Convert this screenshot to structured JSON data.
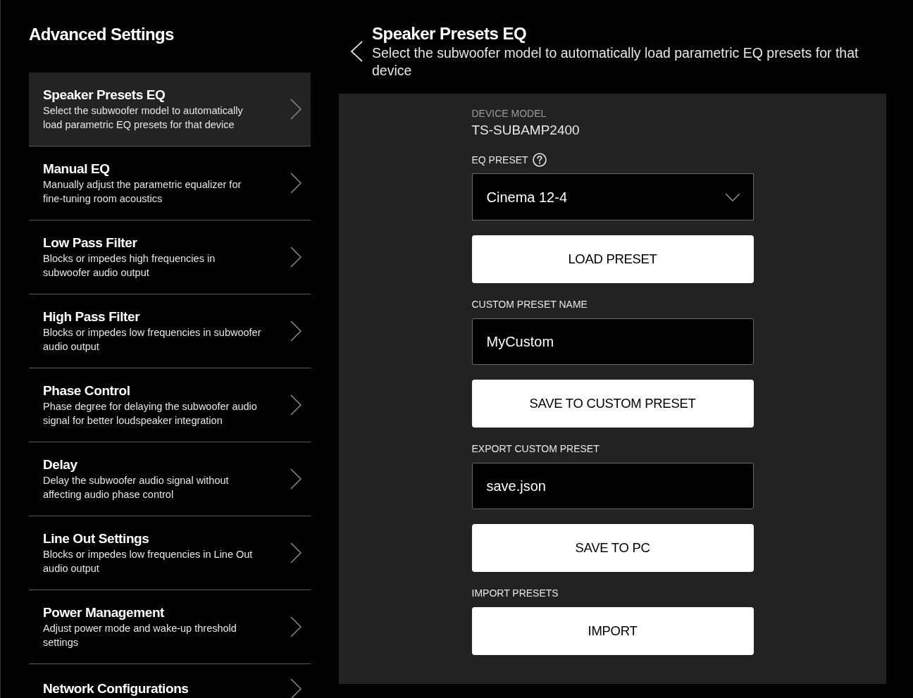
{
  "sidebar": {
    "title": "Advanced Settings",
    "items": [
      {
        "title": "Speaker Presets EQ",
        "description": "Select the subwoofer model to automatically load parametric EQ presets for that device",
        "selected": true
      },
      {
        "title": "Manual EQ",
        "description": "Manually adjust the parametric equalizer for fine-tuning room acoustics",
        "selected": false
      },
      {
        "title": "Low Pass Filter",
        "description": "Blocks or impedes high frequencies in subwoofer audio output",
        "selected": false
      },
      {
        "title": "High Pass Filter",
        "description": "Blocks or impedes low frequencies in subwoofer audio output",
        "selected": false
      },
      {
        "title": "Phase Control",
        "description": "Phase degree for delaying the subwoofer audio signal for better loudspeaker integration",
        "selected": false
      },
      {
        "title": "Delay",
        "description": "Delay the subwoofer audio signal without affecting audio phase control",
        "selected": false
      },
      {
        "title": "Line Out Settings",
        "description": "Blocks or impedes low frequencies in Line Out audio output",
        "selected": false
      },
      {
        "title": "Power Management",
        "description": "Adjust power mode and wake-up threshold settings",
        "selected": false
      },
      {
        "title": "Network Configurations",
        "selected": false
      }
    ]
  },
  "header": {
    "title": "Speaker Presets EQ",
    "subtitle": "Select the subwoofer model to automatically load parametric EQ presets for that device"
  },
  "form": {
    "items": [
      {
        "kind": "readout",
        "label": "DEVICE MODEL",
        "value": "TS-SUBAMP2400"
      },
      {
        "kind": "select",
        "label": "EQ PRESET",
        "help": true,
        "value": "Cinema 12-4"
      },
      {
        "kind": "button",
        "label": "LOAD PRESET"
      },
      {
        "kind": "input",
        "label": "CUSTOM PRESET NAME",
        "value": "MyCustom"
      },
      {
        "kind": "button",
        "label": "SAVE TO CUSTOM PRESET"
      },
      {
        "kind": "input",
        "label": "EXPORT CUSTOM PRESET",
        "value": "save.json"
      },
      {
        "kind": "button",
        "label": "SAVE TO PC"
      },
      {
        "kind": "heading",
        "label": "IMPORT PRESETS"
      },
      {
        "kind": "button",
        "label": "IMPORT"
      }
    ]
  }
}
